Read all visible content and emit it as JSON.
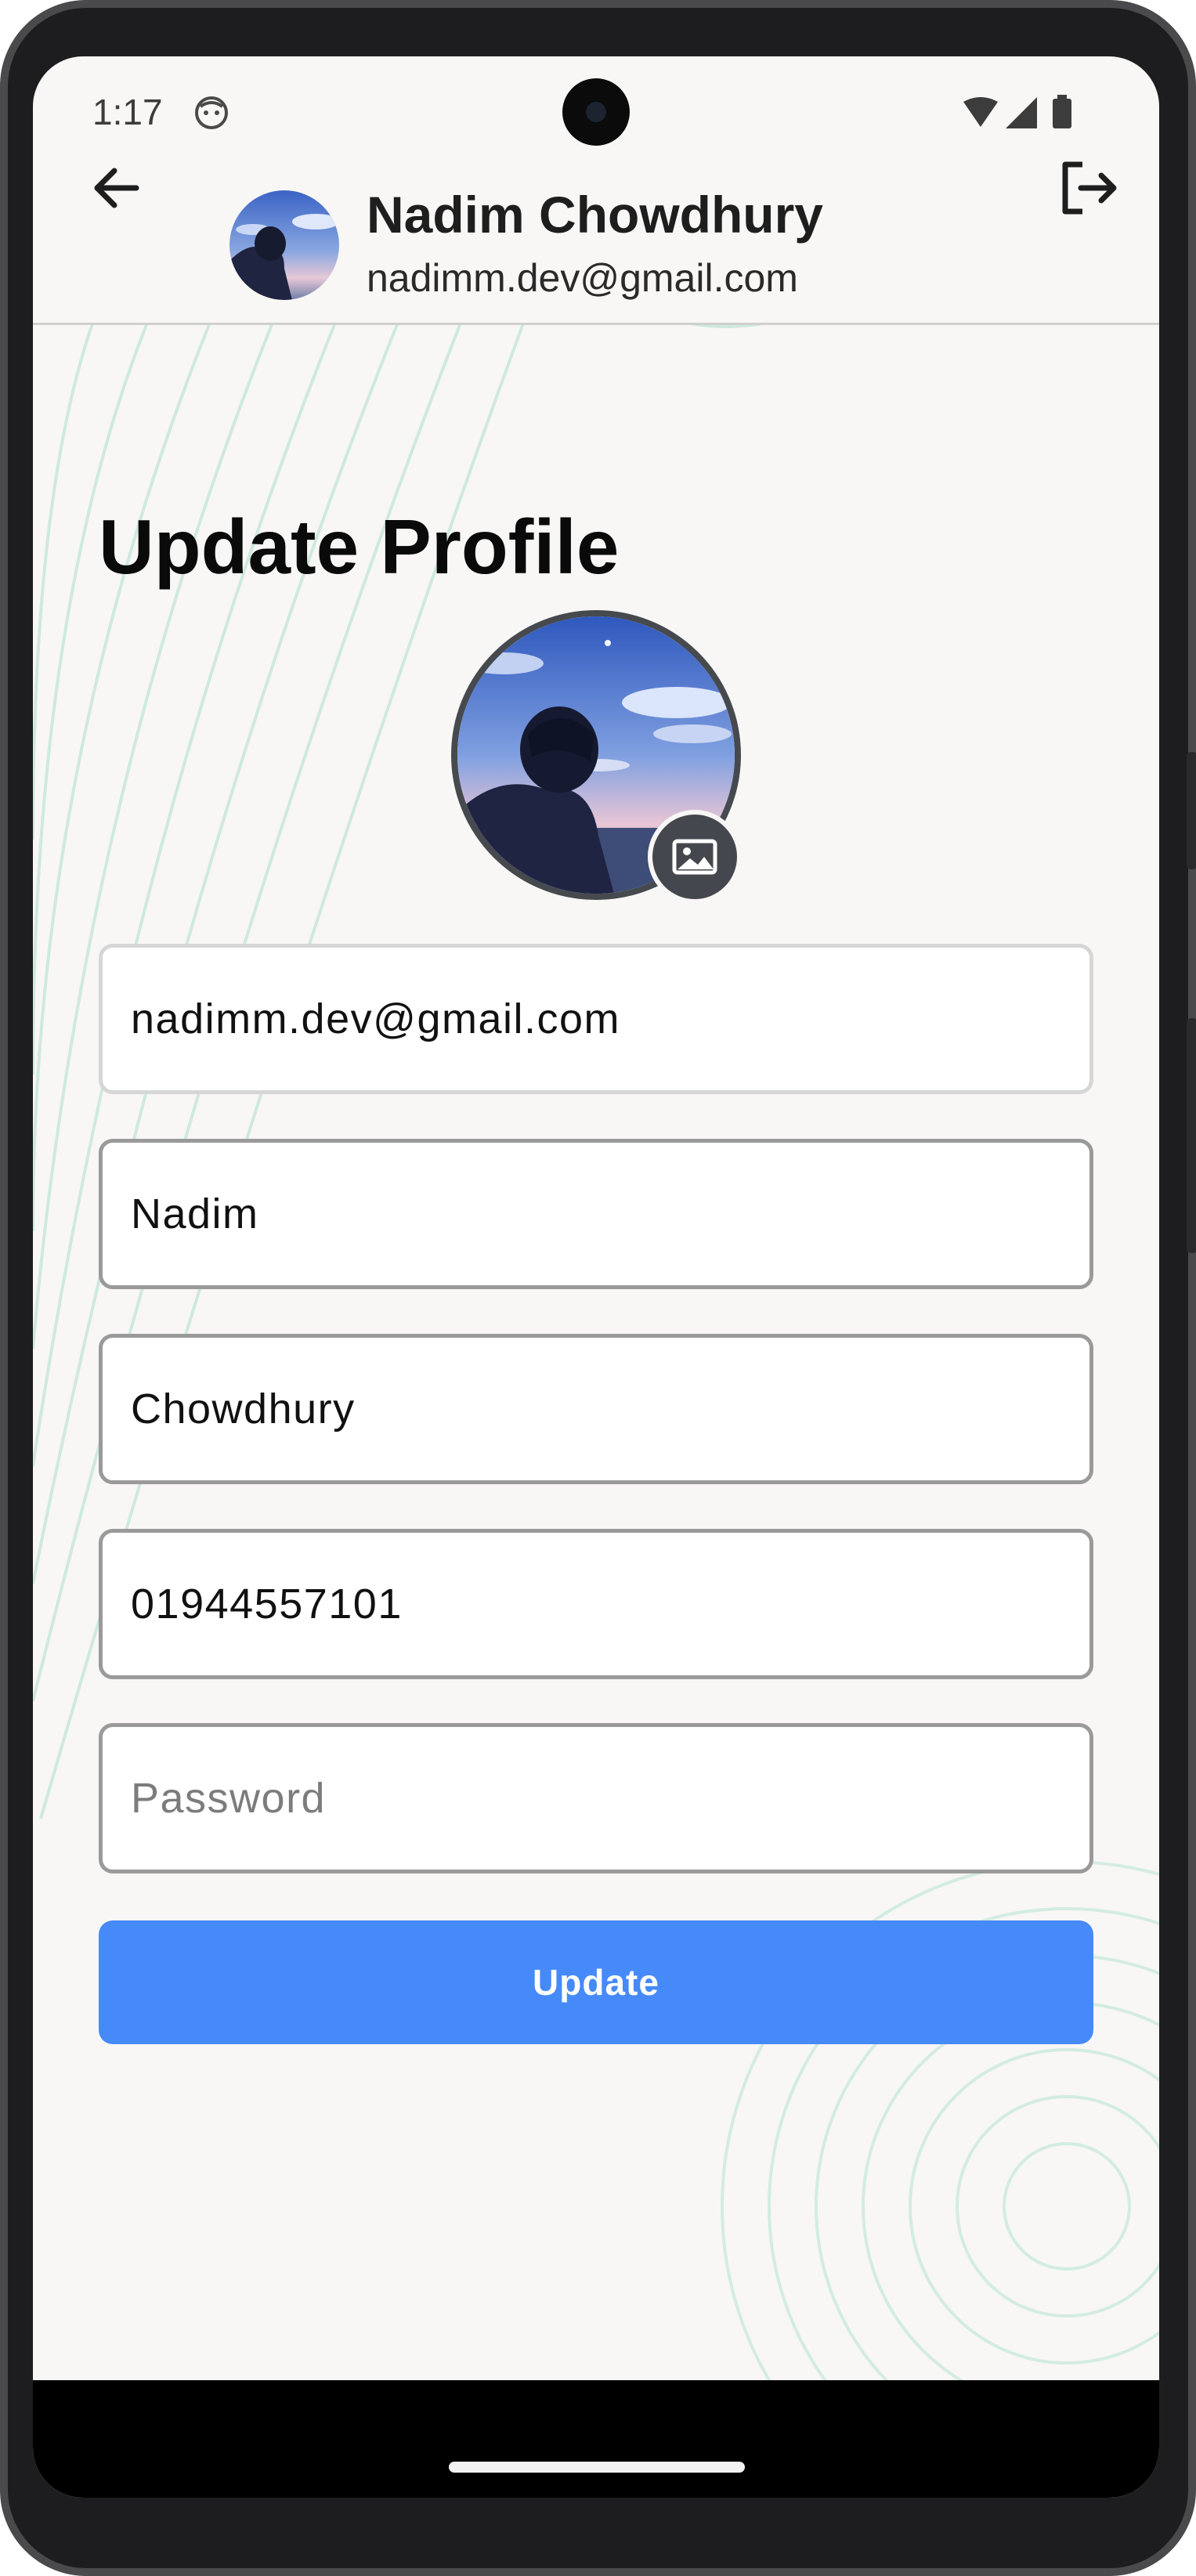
{
  "status_bar": {
    "time": "1:17"
  },
  "header": {
    "user_name": "Nadim Chowdhury",
    "user_email": "nadimm.dev@gmail.com",
    "back_icon": "arrow-left-icon",
    "logout_icon": "logout-icon"
  },
  "page": {
    "title": "Update Profile"
  },
  "form": {
    "email": {
      "value": "nadimm.dev@gmail.com"
    },
    "first_name": {
      "value": "Nadim"
    },
    "last_name": {
      "value": "Chowdhury"
    },
    "phone": {
      "value": "01944557101"
    },
    "password": {
      "value": "",
      "placeholder": "Password"
    },
    "submit_label": "Update"
  },
  "colors": {
    "primary": "#468af9",
    "background": "#f8f7f5",
    "decor_lines": "#cfe9df"
  }
}
